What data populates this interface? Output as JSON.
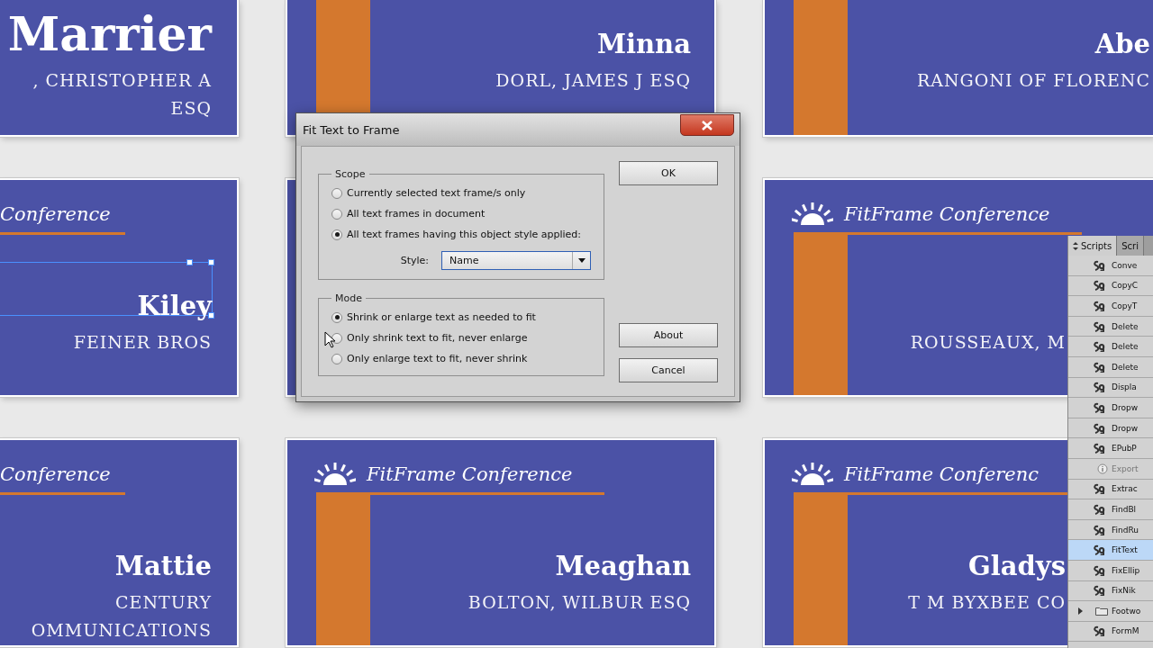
{
  "cards": [
    {
      "kind": "large",
      "selected": false,
      "name": "Marrier",
      "company": [
        ", CHRISTOPHER A",
        "ESQ"
      ]
    },
    {
      "kind": "standard",
      "selected": false,
      "name": "Minna",
      "company": [
        "DORL, JAMES J ESQ"
      ]
    },
    {
      "kind": "standard",
      "selected": false,
      "name": "Abe",
      "company": [
        "RANGONI OF FLORENC"
      ]
    },
    {
      "kind": "standard",
      "selected": true,
      "header": "Conference",
      "name": "Kiley",
      "company": [
        "FEINER BROS"
      ]
    },
    {
      "kind": "standard",
      "selected": false
    },
    {
      "kind": "standard",
      "selected": false,
      "header": "FitFrame Conference",
      "company": [
        "ROUSSEAUX, M"
      ]
    },
    {
      "kind": "standard",
      "selected": false,
      "header": "Conference",
      "name": "Mattie",
      "company": [
        "CENTURY",
        "OMMUNICATIONS"
      ]
    },
    {
      "kind": "standard",
      "selected": false,
      "header": "FitFrame Conference",
      "name": "Meaghan",
      "company": [
        "BOLTON, WILBUR ESQ"
      ]
    },
    {
      "kind": "standard",
      "selected": false,
      "header": "FitFrame Conferenc",
      "name": "Gladys",
      "company": [
        "T M BYXBEE CO"
      ]
    }
  ],
  "dialog": {
    "title": "Fit Text to Frame",
    "scope": {
      "legend": "Scope",
      "options": [
        {
          "label": "Currently selected text frame/s only",
          "selected": false
        },
        {
          "label": "All text frames in document",
          "selected": false
        },
        {
          "label": "All text frames having this object style applied:",
          "selected": true
        }
      ],
      "style_label": "Style:",
      "style_value": "Name"
    },
    "mode": {
      "legend": "Mode",
      "options": [
        {
          "label": "Shrink or enlarge text as needed to fit",
          "selected": true
        },
        {
          "label": "Only shrink text to fit, never enlarge",
          "selected": false
        },
        {
          "label": "Only enlarge text to fit, never shrink",
          "selected": false
        }
      ]
    },
    "buttons": {
      "ok": "OK",
      "about": "About",
      "cancel": "Cancel"
    }
  },
  "scripts_panel": {
    "tabs": [
      {
        "label": "Scripts",
        "selected": true
      },
      {
        "label": "Scri",
        "selected": false
      }
    ],
    "items": [
      {
        "kind": "script",
        "label": "Conve",
        "selected": false
      },
      {
        "kind": "script",
        "label": "CopyC",
        "selected": false
      },
      {
        "kind": "script",
        "label": "CopyT",
        "selected": false
      },
      {
        "kind": "script",
        "label": "Delete",
        "selected": false
      },
      {
        "kind": "script",
        "label": "Delete",
        "selected": false
      },
      {
        "kind": "script",
        "label": "Delete",
        "selected": false
      },
      {
        "kind": "script",
        "label": "Displa",
        "selected": false
      },
      {
        "kind": "script",
        "label": "Dropw",
        "selected": false
      },
      {
        "kind": "script",
        "label": "Dropw",
        "selected": false
      },
      {
        "kind": "script",
        "label": "EPubP",
        "selected": false
      },
      {
        "kind": "info",
        "label": "Export",
        "selected": false
      },
      {
        "kind": "script",
        "label": "Extrac",
        "selected": false
      },
      {
        "kind": "script",
        "label": "FindBl",
        "selected": false
      },
      {
        "kind": "script",
        "label": "FindRu",
        "selected": false
      },
      {
        "kind": "script",
        "label": "FitText",
        "selected": true
      },
      {
        "kind": "script",
        "label": "FixEllip",
        "selected": false
      },
      {
        "kind": "script",
        "label": "FixNik",
        "selected": false
      },
      {
        "kind": "folder",
        "label": "Footwo",
        "selected": false
      },
      {
        "kind": "script",
        "label": "FormM",
        "selected": false
      }
    ]
  }
}
